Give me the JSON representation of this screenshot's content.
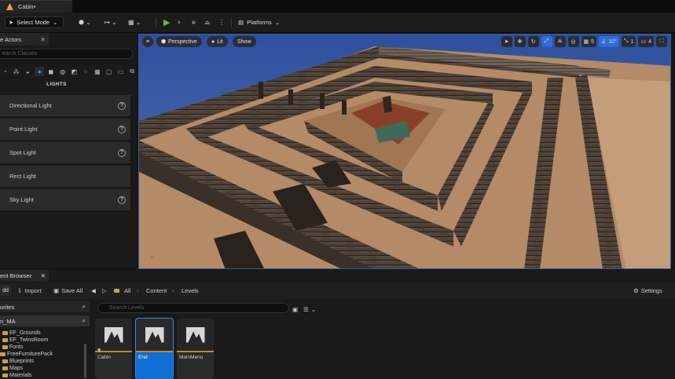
{
  "title_bar": {
    "doc_tab": "Cabin•"
  },
  "toolbar": {
    "mode_select": "Select Mode",
    "platforms": "Platforms"
  },
  "place_actors": {
    "tab_label": "e Actors",
    "search_placeholder": "earch Classes",
    "section_label": "LIGHTS",
    "items": [
      {
        "label": "Directional Light"
      },
      {
        "label": "Point Light"
      },
      {
        "label": "Spot Light"
      },
      {
        "label": "Rect Light"
      },
      {
        "label": "Sky Light"
      }
    ]
  },
  "viewport": {
    "perspective": "Perspective",
    "lit": "Lit",
    "show": "Show",
    "grid_snap": "5",
    "rotation_snap": "10°",
    "scale_snap": "1",
    "camera_speed": "4"
  },
  "content_browser": {
    "tab_label": "ent Browser",
    "add_label": "dd",
    "import_label": "Import",
    "save_all_label": "Save All",
    "breadcrumb": [
      "All",
      "Content",
      "Levels"
    ],
    "settings_label": "Settings",
    "favorites_label": "orites",
    "project_label": "n_MA",
    "search_placeholder": "Search Levels",
    "tree": [
      {
        "label": "EF_Grounds"
      },
      {
        "label": "EF_TwinsRoom"
      },
      {
        "label": "Fonts"
      },
      {
        "label": "FreeFurniturePack"
      },
      {
        "label": "Blueprints"
      },
      {
        "label": "Maps"
      },
      {
        "label": "Materials"
      }
    ],
    "assets": [
      {
        "label": "Cabin"
      },
      {
        "label": "End"
      },
      {
        "label": "MainMenu"
      }
    ]
  },
  "colors": {
    "accent": "#2f6ed8",
    "asset_stripe": "#c58a1e",
    "play_green": "#5fbf3b"
  }
}
